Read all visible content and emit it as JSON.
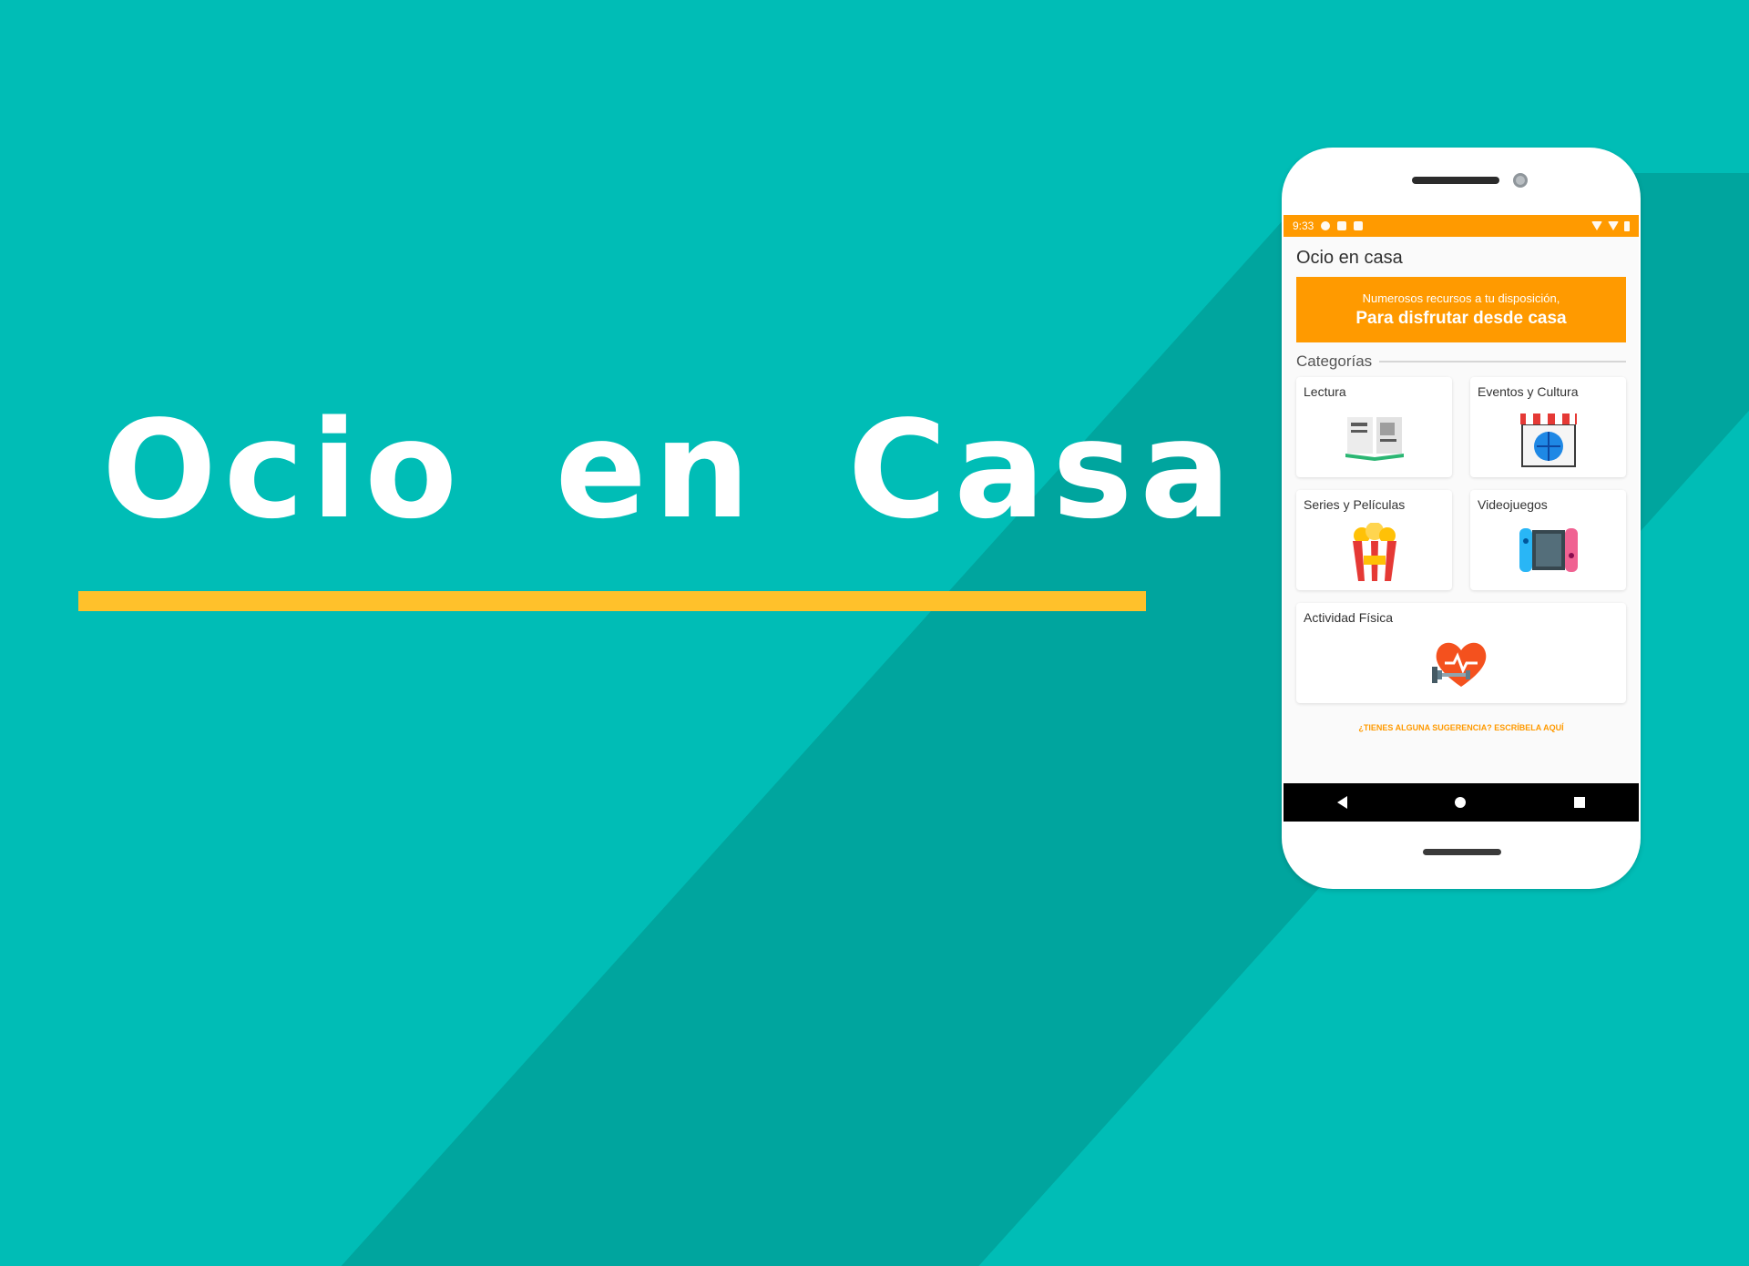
{
  "headline": {
    "title": "Ocio en Casa"
  },
  "colors": {
    "background": "#00BDB6",
    "accent_bar": "#FFC12B",
    "app_orange": "#FF9A00"
  },
  "phone": {
    "status_bar": {
      "time": "9:33",
      "icons": [
        "settings-icon",
        "sim-icon",
        "sd-card-icon",
        "wifi-icon",
        "signal-icon",
        "battery-icon"
      ]
    },
    "app_title": "Ocio en casa",
    "banner": {
      "line1": "Numerosos recursos a tu disposición,",
      "line2": "Para disfrutar desde casa"
    },
    "categories_heading": "Categorías",
    "categories": [
      {
        "label": "Lectura",
        "icon": "book-icon"
      },
      {
        "label": "Eventos y Cultura",
        "icon": "globe-shop-icon"
      },
      {
        "label": "Series y Películas",
        "icon": "popcorn-icon"
      },
      {
        "label": "Videojuegos",
        "icon": "game-console-icon"
      },
      {
        "label": "Actividad Física",
        "icon": "heart-dumbbell-icon"
      }
    ],
    "suggestion_link": "¿TIENES ALGUNA SUGERENCIA? ESCRÍBELA AQUÍ",
    "nav_buttons": [
      "back",
      "home",
      "recent-apps"
    ]
  }
}
